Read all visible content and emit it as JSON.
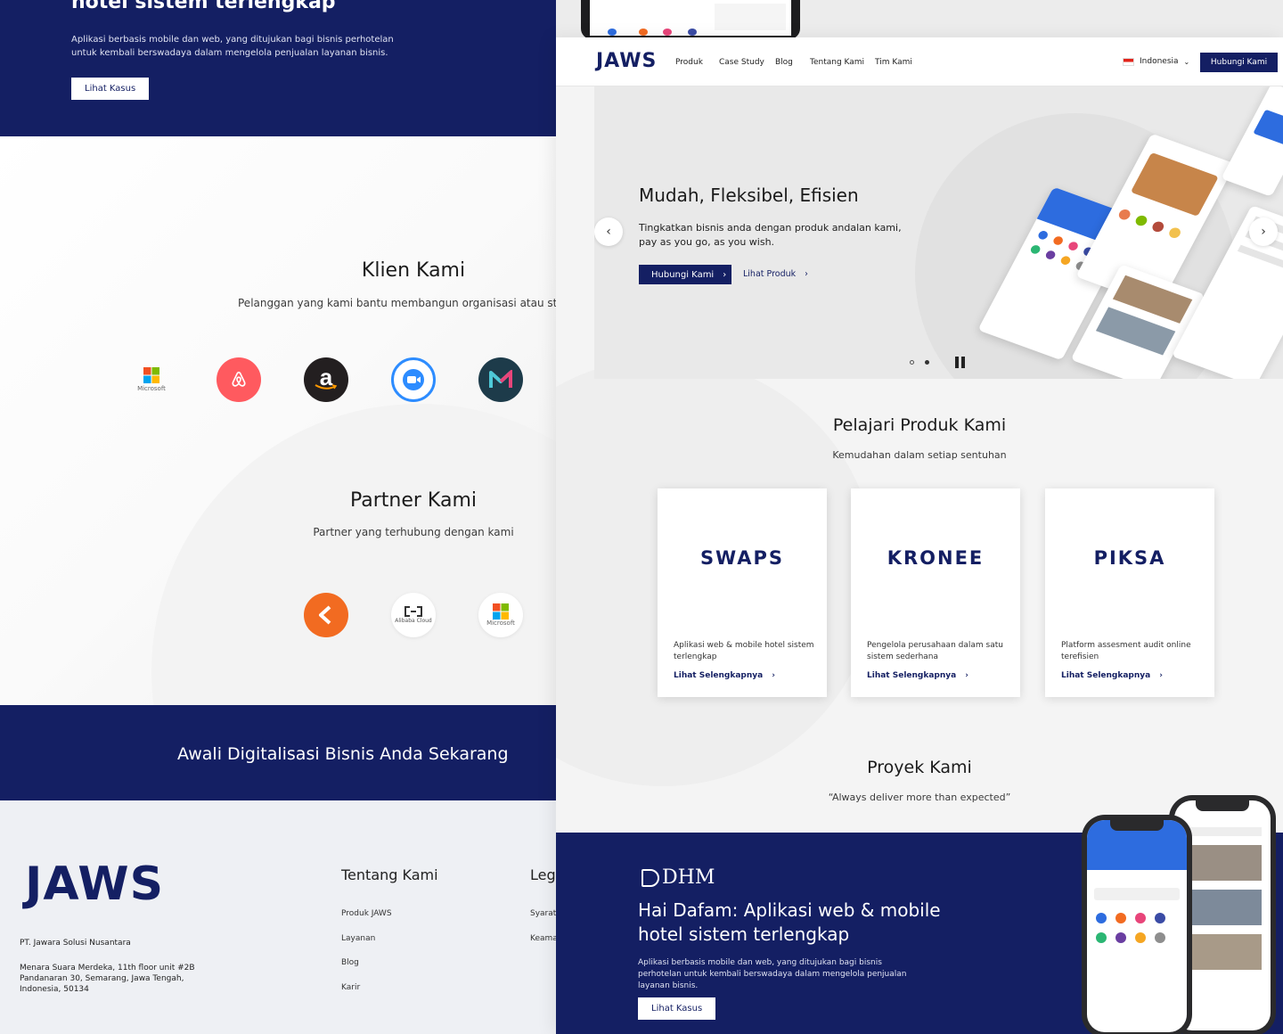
{
  "left": {
    "hero": {
      "title": "hotel sistem terlengkap",
      "desc": "Aplikasi berbasis mobile dan web, yang ditujukan bagi bisnis perhotelan untuk kembali berswadaya dalam mengelola penjualan layanan bisnis.",
      "button": "Lihat Kasus"
    },
    "klien": {
      "title": "Klien Kami",
      "subtitle": "Pelanggan yang kami bantu membangun organisasi atau st",
      "logos": [
        "Microsoft",
        "airbnb",
        "amazon",
        "zoom",
        "Medium"
      ]
    },
    "partner": {
      "title": "Partner Kami",
      "subtitle": "Partner yang terhubung dengan kami",
      "logos": [
        "Flutter",
        "Alibaba Cloud",
        "Microsoft"
      ]
    },
    "cta": "Awali Digitalisasi Bisnis Anda Sekarang",
    "footer": {
      "logo": "JAWS",
      "company": "PT. Jawara Solusi Nusantara",
      "address": "Menara Suara Merdeka, 11th floor unit #2B Pandanaran 30, Semarang, Jawa Tengah, Indonesia, 50134",
      "col1_title": "Tentang Kami",
      "col1_links": [
        "Produk JAWS",
        "Layanan",
        "Blog",
        "Karir"
      ],
      "col2_title": "Leg",
      "col2_links": [
        "Syarat",
        "Keama"
      ]
    }
  },
  "right": {
    "nav": {
      "logo": "JAWS",
      "links": [
        "Produk",
        "Case Study",
        "Blog",
        "Tentang Kami",
        "Tim Kami"
      ],
      "language": "Indonesia",
      "cta": "Hubungi Kami"
    },
    "hero": {
      "title": "Mudah, Fleksibel, Efisien",
      "desc": "Tingkatkan bisnis anda dengan produk andalan kami, pay as you go, as you wish.",
      "cta": "Hubungi Kami",
      "link": "Lihat Produk"
    },
    "produk": {
      "title": "Pelajari Produk Kami",
      "subtitle": "Kemudahan dalam setiap sentuhan",
      "cards": [
        {
          "logo": "SWAPS",
          "desc": "Aplikasi web & mobile hotel sistem terlengkap",
          "more": "Lihat Selengkapnya"
        },
        {
          "logo": "KRONEE",
          "desc": "Pengelola perusahaan dalam satu sistem sederhana",
          "more": "Lihat Selengkapnya"
        },
        {
          "logo": "PIKSA",
          "desc": "Platform assesment audit online terefisien",
          "more": "Lihat Selengkapnya"
        }
      ]
    },
    "proyek": {
      "title": "Proyek Kami",
      "subtitle": "“Always deliver more than expected”"
    },
    "dhm": {
      "logo": "DHM",
      "title": "Hai Dafam: Aplikasi web & mobile hotel sistem terlengkap",
      "desc": "Aplikasi berbasis mobile dan web, yang ditujukan bagi bisnis perhotelan untuk kembali berswadaya dalam mengelola penjualan layanan bisnis.",
      "button": "Lihat Kasus"
    }
  },
  "colors": {
    "navy": "#141f63",
    "airbnb": "#ff5a5f",
    "zoom": "#2d8cff",
    "flutter": "#f26b21"
  }
}
